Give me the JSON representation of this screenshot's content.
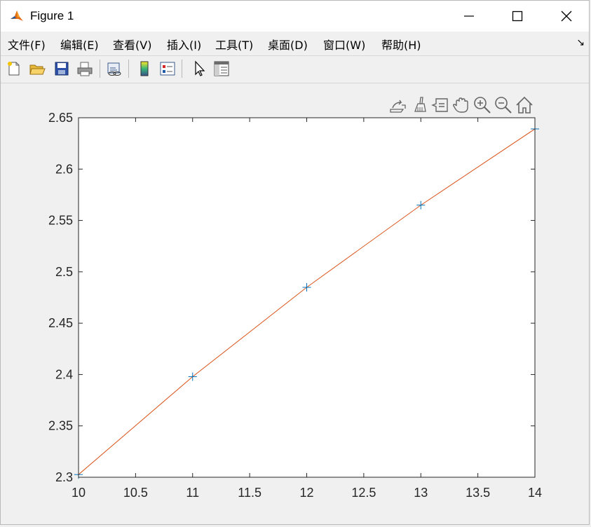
{
  "window": {
    "title": "Figure 1"
  },
  "menu": [
    "文件(F)",
    "编辑(E)",
    "查看(V)",
    "插入(I)",
    "工具(T)",
    "桌面(D)",
    "窗口(W)",
    "帮助(H)"
  ],
  "toolbar_icons": [
    "new-figure-icon",
    "open-file-icon",
    "save-icon",
    "print-icon",
    "link-plot-icon",
    "colorbar-icon",
    "legend-icon",
    "select-arrow-icon",
    "property-inspector-icon"
  ],
  "axes_toolbar_icons": [
    "export-icon",
    "brush-icon",
    "data-tips-icon",
    "pan-icon",
    "zoom-in-icon",
    "zoom-out-icon",
    "home-icon"
  ],
  "chart_data": {
    "type": "line",
    "title": "",
    "xlabel": "",
    "ylabel": "",
    "xlim": [
      10,
      14
    ],
    "ylim": [
      2.3,
      2.65
    ],
    "xticks": [
      "10",
      "10.5",
      "11",
      "11.5",
      "12",
      "12.5",
      "13",
      "13.5",
      "14"
    ],
    "yticks": [
      "2.3",
      "2.35",
      "2.4",
      "2.45",
      "2.5",
      "2.55",
      "2.6",
      "2.65"
    ],
    "grid": false,
    "series": [
      {
        "x": [
          10,
          11,
          12,
          13,
          14
        ],
        "y": [
          2.3026,
          2.3979,
          2.4849,
          2.5649,
          2.6391
        ],
        "marker": "+",
        "line": "none",
        "color": "#0072bd"
      },
      {
        "x": [
          10,
          11,
          12,
          13,
          14
        ],
        "y": [
          2.3026,
          2.3979,
          2.4849,
          2.5649,
          2.6391
        ],
        "marker": "none",
        "line": "solid",
        "color": "#d95319"
      }
    ]
  }
}
